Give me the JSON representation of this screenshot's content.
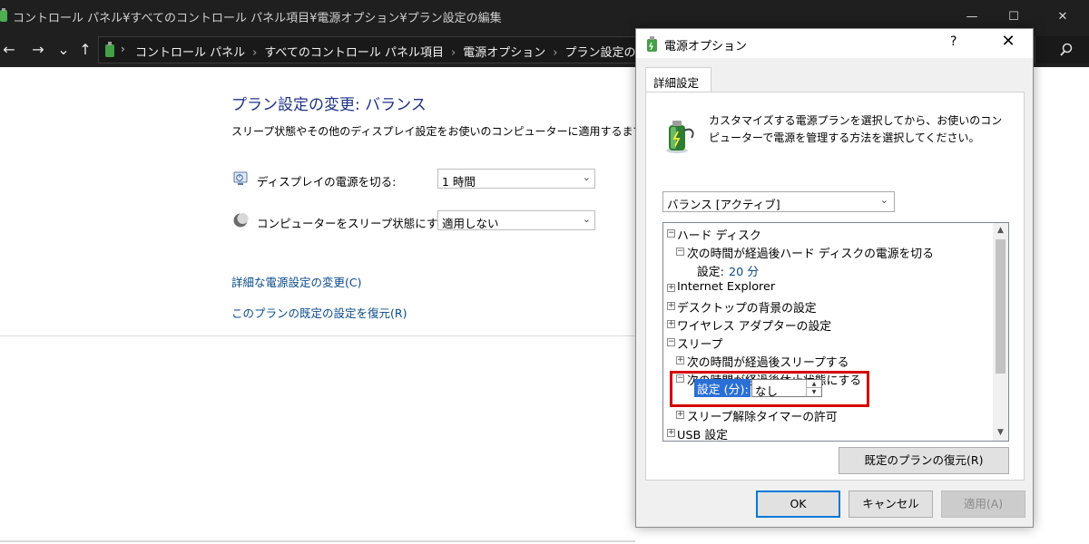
{
  "window": {
    "title": "コントロール パネル¥すべてのコントロール パネル項目¥電源オプション¥プラン設定の編集",
    "controls": {
      "minimize": "—",
      "maximize": "☐",
      "close": "✕"
    }
  },
  "nav": {
    "back": "←",
    "forward": "→",
    "recent": "⌄",
    "up": "↑"
  },
  "address": {
    "crumbs": [
      "コントロール パネル",
      "すべてのコントロール パネル項目",
      "電源オプション",
      "プラン設定の編集"
    ],
    "separator": "›"
  },
  "main": {
    "title": "プラン設定の変更: バランス",
    "description": "スリープ状態やその他のディスプレイ設定をお使いのコンピューターに適用するまでの時",
    "settings": [
      {
        "label": "ディスプレイの電源を切る:",
        "value": "1 時間",
        "icon": "monitor-icon"
      },
      {
        "label": "コンピューターをスリープ状態にする:",
        "value": "適用しない",
        "icon": "moon-icon"
      }
    ],
    "links": [
      "詳細な電源設定の変更(C)",
      "このプランの既定の設定を復元(R)"
    ]
  },
  "dialog": {
    "title": "電源オプション",
    "help": "?",
    "close": "✕",
    "tab": "詳細設定",
    "intro": "カスタマイズする電源プランを選択してから、お使いのコンピューターで電源を管理する方法を選択してください。",
    "plan": "バランス [アクティブ]",
    "tree": [
      {
        "text": "ハード ディスク",
        "exp": "−"
      },
      {
        "text": "次の時間が経過後ハード ディスクの電源を切る",
        "exp": "−"
      },
      {
        "text": "設定:",
        "value": "20 分"
      },
      {
        "text": "Internet Explorer",
        "exp": "+"
      },
      {
        "text": "デスクトップの背景の設定",
        "exp": "+"
      },
      {
        "text": "ワイヤレス アダプターの設定",
        "exp": "+"
      },
      {
        "text": "スリープ",
        "exp": "−"
      },
      {
        "text": "次の時間が経過後スリープする",
        "exp": "+"
      },
      {
        "text": "次の時間が経過後休止状態にする",
        "exp": "−"
      },
      {
        "text": "スリープ解除タイマーの許可",
        "exp": "+"
      },
      {
        "text": "USB 設定",
        "exp": "+"
      }
    ],
    "edit": {
      "label": "設定 (分):",
      "value": "なし"
    },
    "restore_button": "既定のプランの復元(R)",
    "ok_button": "OK",
    "cancel_button": "キャンセル",
    "apply_button": "適用(A)"
  },
  "colors": {
    "highlight": "#d40000",
    "selection": "#2a6fd6",
    "link": "#0a4a8a",
    "title": "#1e3287"
  }
}
